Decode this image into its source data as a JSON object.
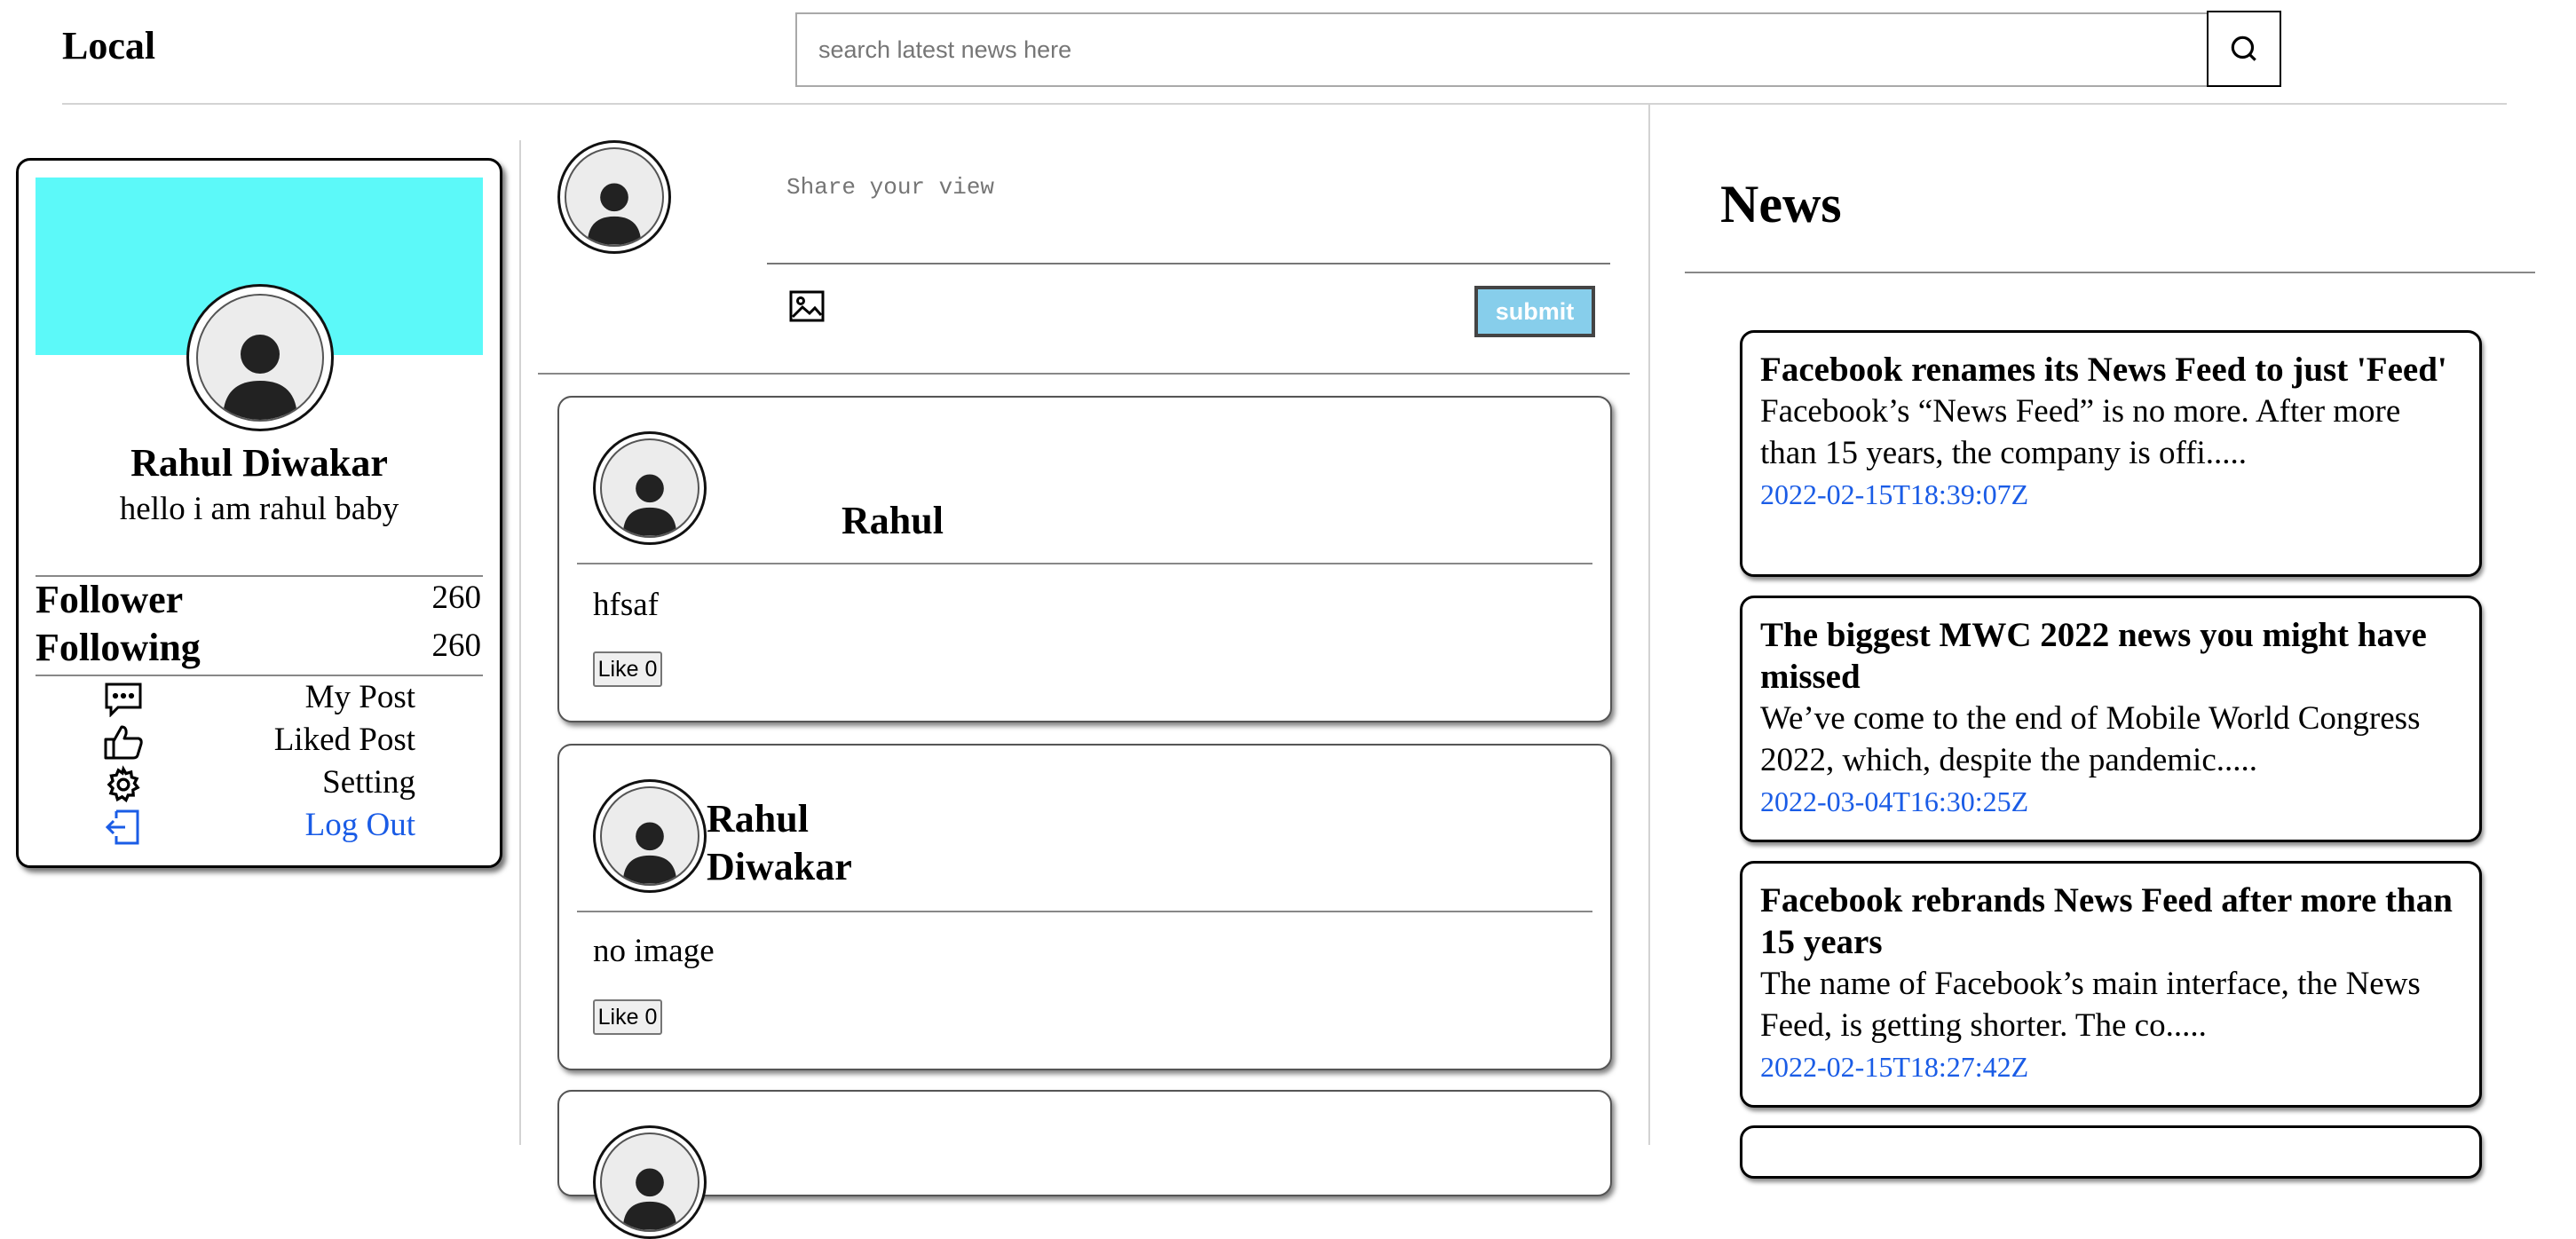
{
  "header": {
    "brand": "Local",
    "search_placeholder": "search latest news here",
    "search_icon": "search-icon"
  },
  "profile": {
    "name": "Rahul Diwakar",
    "bio": "hello i am rahul baby",
    "cover_color": "#5cf9f9",
    "stats": [
      {
        "label": "Follower",
        "value": "260"
      },
      {
        "label": "Following",
        "value": "260"
      }
    ],
    "menu": [
      {
        "label": "My Post",
        "icon": "comment-dots-icon"
      },
      {
        "label": "Liked Post",
        "icon": "thumbs-up-icon"
      },
      {
        "label": "Setting",
        "icon": "gear-icon"
      },
      {
        "label": "Log Out",
        "icon": "logout-icon"
      }
    ]
  },
  "composer": {
    "placeholder": "Share your view",
    "submit_label": "submit",
    "image_icon": "image-icon"
  },
  "posts": [
    {
      "author": "Rahul",
      "text": "hfsaf",
      "like_label": "Like 0"
    },
    {
      "author": "Rahul Diwakar",
      "text": "no image",
      "like_label": "Like 0"
    }
  ],
  "news": {
    "title": "News",
    "items": [
      {
        "title": "Facebook renames its News Feed to just 'Feed'",
        "description": "Facebook’s “News Feed” is no more. After more than 15 years, the company is offi.....",
        "date": "2022-02-15T18:39:07Z"
      },
      {
        "title": "The biggest MWC 2022 news you might have missed",
        "description": "We’ve come to the end of Mobile World Congress 2022, which, despite the pandemic.....",
        "date": "2022-03-04T16:30:25Z"
      },
      {
        "title": "Facebook rebrands News Feed after more than 15 years",
        "description": "The name of Facebook’s main interface, the News Feed, is getting shorter. The co.....",
        "date": "2022-02-15T18:27:42Z"
      }
    ]
  },
  "colors": {
    "accent_link": "#1a5ce6",
    "submit_bg": "#87ceeb"
  }
}
